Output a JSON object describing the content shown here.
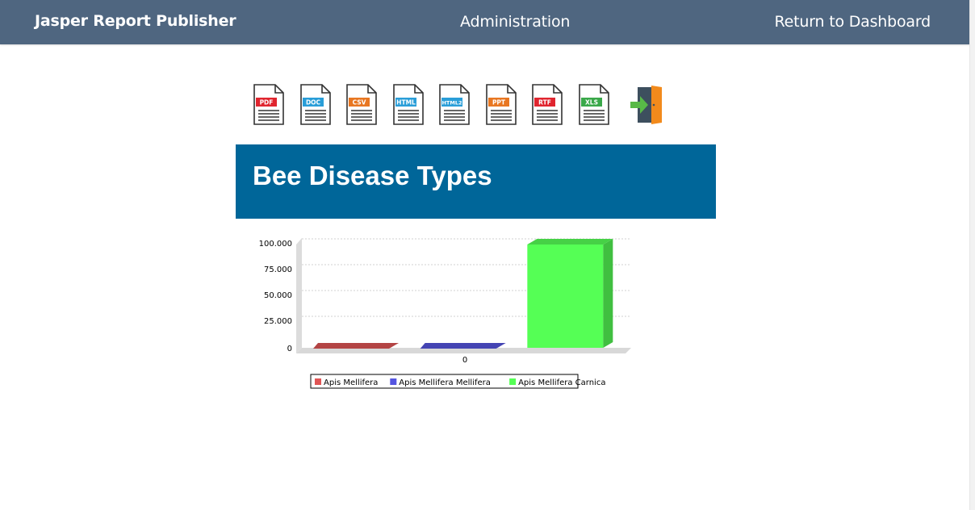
{
  "navbar": {
    "brand": "Jasper Report Publisher",
    "admin_label": "Administration",
    "return_label": "Return to Dashboard",
    "background": "#4f6680"
  },
  "toolbar": {
    "exports": [
      {
        "label": "PDF",
        "color": "#e0252f",
        "icon": "pdf-file-icon"
      },
      {
        "label": "DOC",
        "color": "#2a9ed8",
        "icon": "doc-file-icon"
      },
      {
        "label": "CSV",
        "color": "#e87722",
        "icon": "csv-file-icon"
      },
      {
        "label": "HTML",
        "color": "#2a9ed8",
        "icon": "html-file-icon"
      },
      {
        "label": "HTML2",
        "color": "#2a9ed8",
        "icon": "html2-file-icon"
      },
      {
        "label": "PPT",
        "color": "#e87722",
        "icon": "ppt-file-icon"
      },
      {
        "label": "RTF",
        "color": "#e0252f",
        "icon": "rtf-file-icon"
      },
      {
        "label": "XLS",
        "color": "#3aa84a",
        "icon": "xls-file-icon"
      }
    ],
    "exit_icon": "exit-door-icon"
  },
  "report": {
    "title": "Bee Disease Types",
    "header_color": "#006699"
  },
  "chart_data": {
    "type": "bar",
    "categories": [
      "0"
    ],
    "series": [
      {
        "name": "Apis Mellifera",
        "values": [
          0
        ],
        "color": "#e05555"
      },
      {
        "name": "Apis Mellifera Mellifera",
        "values": [
          0
        ],
        "color": "#5555e0"
      },
      {
        "name": "Apis Mellifera Carnica",
        "values": [
          100000
        ],
        "color": "#55ff55"
      }
    ],
    "y_ticks": [
      "0",
      "25.000",
      "50.000",
      "75.000",
      "100.000"
    ],
    "ylim": [
      0,
      100000
    ],
    "grid": true,
    "legend": "bottom",
    "style": "3d"
  }
}
